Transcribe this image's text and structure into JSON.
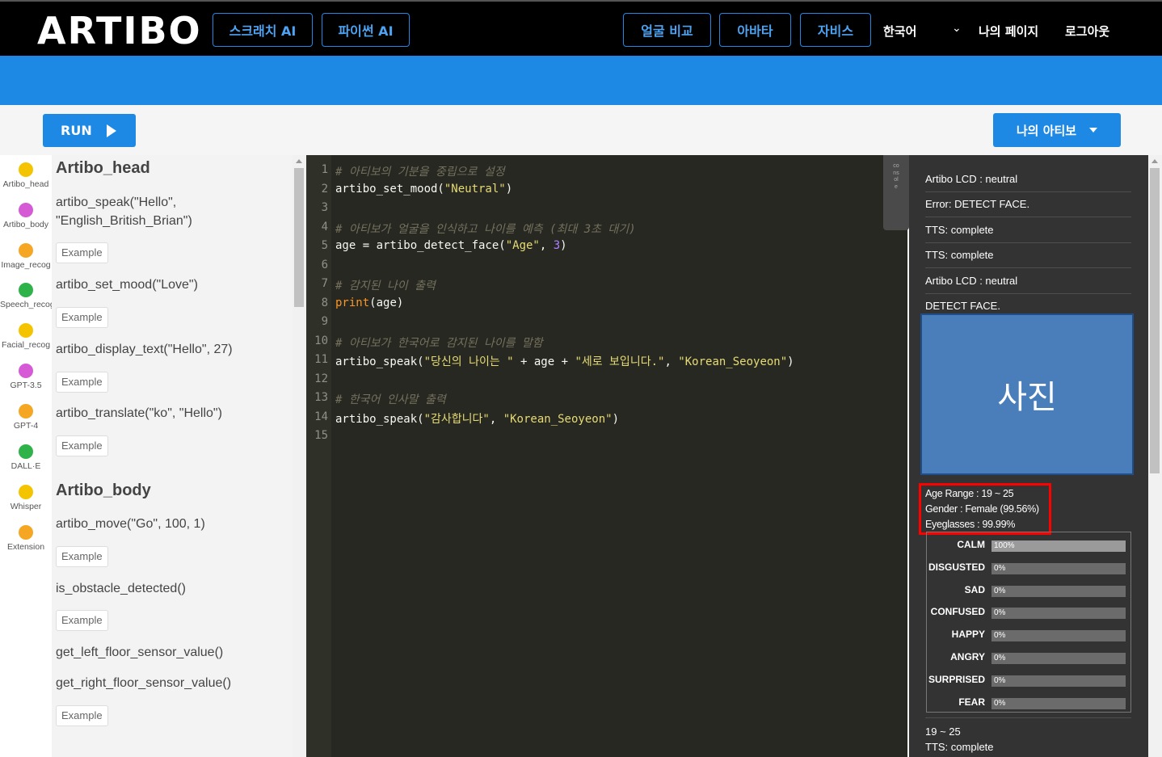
{
  "nav": {
    "logo": "ARTIBO",
    "scratch_ai": "스크래치 AI",
    "python_ai": "파이썬 AI",
    "face_compare": "얼굴 비교",
    "avatar": "아바타",
    "jarvis": "자비스",
    "language": "한국어",
    "my_page": "나의 페이지",
    "logout": "로그아웃"
  },
  "toolbar": {
    "run_label": "RUN",
    "my_artibo_label": "나의 아티보"
  },
  "categories": [
    {
      "label": "Artibo_head",
      "color": "#f5c400"
    },
    {
      "label": "Artibo_body",
      "color": "#d65ad6"
    },
    {
      "label": "Image_recog",
      "color": "#f5a623"
    },
    {
      "label": "Speech_recog",
      "color": "#2fb24a"
    },
    {
      "label": "Facial_recog",
      "color": "#f5c400"
    },
    {
      "label": "GPT-3.5",
      "color": "#d65ad6"
    },
    {
      "label": "GPT-4",
      "color": "#f5a623"
    },
    {
      "label": "DALL·E",
      "color": "#2fb24a"
    },
    {
      "label": "Whisper",
      "color": "#f5c400"
    },
    {
      "label": "Extension",
      "color": "#f5a623"
    }
  ],
  "blocks": {
    "head_title": "Artibo_head",
    "speak": "artibo_speak(\"Hello\", \"English_British_Brian\")",
    "set_mood": "artibo_set_mood(\"Love\")",
    "display_text": "artibo_display_text(\"Hello\", 27)",
    "translate": "artibo_translate(\"ko\", \"Hello\")",
    "example": "Example",
    "body_title": "Artibo_body",
    "move": "artibo_move(\"Go\", 100, 1)",
    "obstacle": "is_obstacle_detected()",
    "left_floor": "get_left_floor_sensor_value()",
    "right_floor": "get_right_floor_sensor_value()"
  },
  "code": {
    "line_numbers": [
      "1",
      "2",
      "3",
      "4",
      "5",
      "6",
      "7",
      "8",
      "9",
      "10",
      "11",
      "12",
      "13",
      "14",
      "15"
    ],
    "c1": "# 아티보의 기분을 중립으로 설정",
    "l2_fn": "artibo_set_mood(",
    "l2_str": "\"Neutral\"",
    "l2_end": ")",
    "c4": "# 아티보가 얼굴을 인식하고 나이를 예측 (최대 3초 대기)",
    "l5_a": "age = artibo_detect_face(",
    "l5_str": "\"Age\"",
    "l5_b": ", ",
    "l5_num": "3",
    "l5_end": ")",
    "c7": "# 감지된 나이 출력",
    "l8_kw": "print",
    "l8_rest": "(age)",
    "c10": "# 아티보가 한국어로 감지된 나이를 말함",
    "l11_a": "artibo_speak(",
    "l11_s1": "\"당신의 나이는 \"",
    "l11_b": " + age + ",
    "l11_s2": "\"세로 보입니다.\"",
    "l11_c": ", ",
    "l11_s3": "\"Korean_Seoyeon\"",
    "l11_end": ")",
    "c13": "# 한국어 인사말 출력",
    "l14_a": "artibo_speak(",
    "l14_s1": "\"감사합니다\"",
    "l14_b": ", ",
    "l14_s2": "\"Korean_Seoyeon\"",
    "l14_end": ")"
  },
  "console": {
    "tab_label": "console",
    "logs": [
      "Artibo LCD : neutral",
      "Error: DETECT FACE.",
      "TTS: complete",
      "TTS: complete",
      "Artibo LCD : neutral",
      "DETECT FACE."
    ],
    "photo_label": "사진",
    "age_range": "Age Range : 19 ~ 25",
    "gender": "Gender : Female (99.56%)",
    "eyeglasses": "Eyeglasses : 99.99%",
    "emotions": [
      {
        "name": "CALM",
        "pct_label": "100%",
        "fraction": 1.0
      },
      {
        "name": "DISGUSTED",
        "pct_label": "0%",
        "fraction": 0
      },
      {
        "name": "SAD",
        "pct_label": "0%",
        "fraction": 0
      },
      {
        "name": "CONFUSED",
        "pct_label": "0%",
        "fraction": 0
      },
      {
        "name": "HAPPY",
        "pct_label": "0%",
        "fraction": 0
      },
      {
        "name": "ANGRY",
        "pct_label": "0%",
        "fraction": 0
      },
      {
        "name": "SURPRISED",
        "pct_label": "0%",
        "fraction": 0
      },
      {
        "name": "FEAR",
        "pct_label": "0%",
        "fraction": 0
      }
    ],
    "tail_age": "19 ~ 25",
    "tail_tts": "TTS: complete"
  }
}
